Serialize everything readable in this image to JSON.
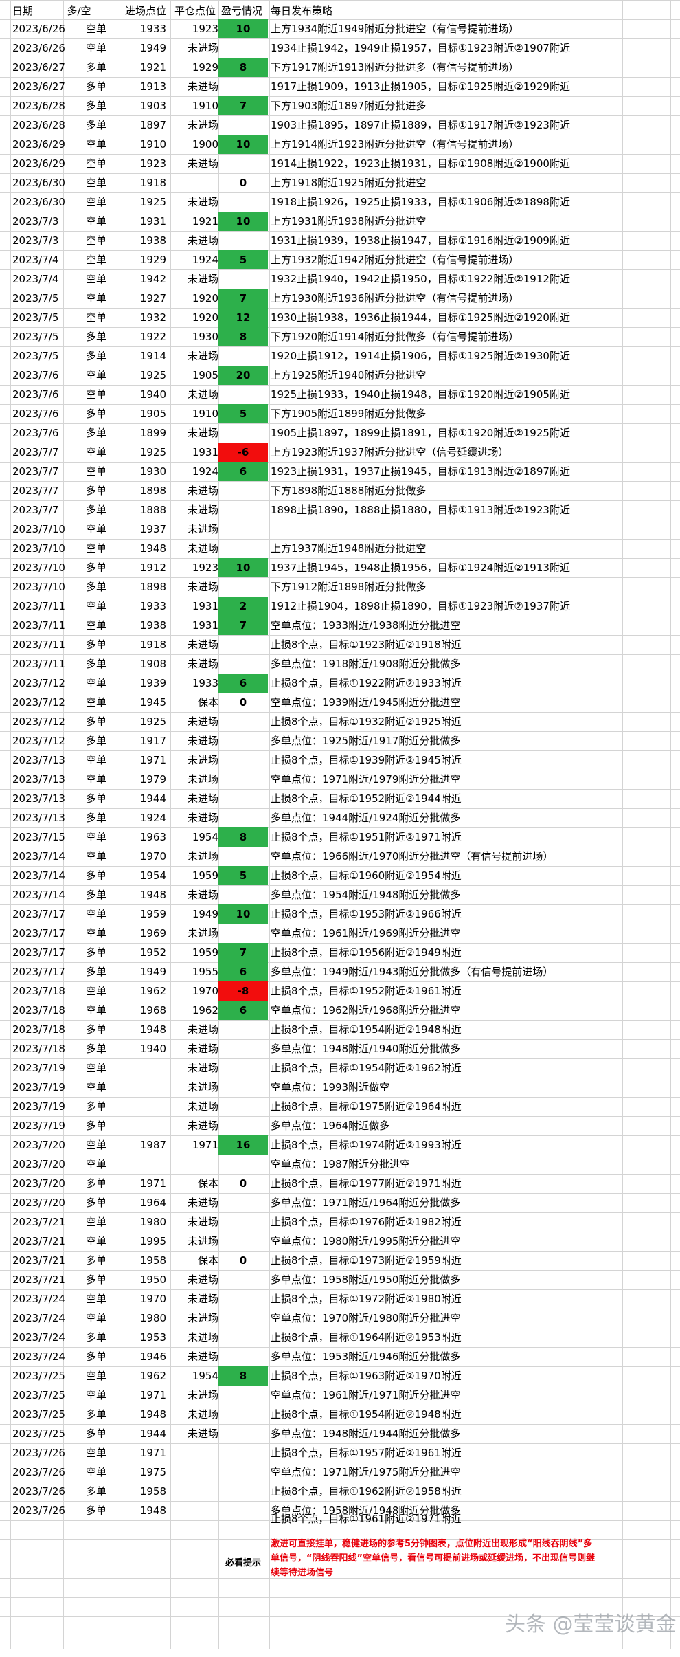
{
  "headers": [
    "日期",
    "多/空",
    "进场点位",
    "平仓点位",
    "盈亏情况",
    "每日发布策略"
  ],
  "rows": [
    [
      "2023/6/26",
      "空单",
      "1933",
      "1923",
      "10",
      "上方1934附近1949附近分批进空（有信号提前进场）"
    ],
    [
      "2023/6/26",
      "空单",
      "1949",
      "未进场",
      "",
      "1934止损1942，1949止损1957，目标①1923附近②1907附近"
    ],
    [
      "2023/6/27",
      "多单",
      "1921",
      "1929",
      "8",
      "下方1917附近1913附近分批进多（有信号提前进场）"
    ],
    [
      "2023/6/27",
      "多单",
      "1913",
      "未进场",
      "",
      "1917止损1909，1913止损1905，目标①1925附近②1929附近"
    ],
    [
      "2023/6/28",
      "多单",
      "1903",
      "1910",
      "7",
      "下方1903附近1897附近分批进多"
    ],
    [
      "2023/6/28",
      "多单",
      "1897",
      "未进场",
      "",
      "1903止损1895，1897止损1889，目标①1917附近②1923附近"
    ],
    [
      "2023/6/29",
      "空单",
      "1910",
      "1900",
      "10",
      "上方1914附近1923附近分批进空（有信号提前进场）"
    ],
    [
      "2023/6/29",
      "空单",
      "1923",
      "未进场",
      "",
      "1914止损1922，1923止损1931，目标①1908附近②1900附近"
    ],
    [
      "2023/6/30",
      "空单",
      "1918",
      "",
      "0",
      "上方1918附近1925附近分批进空"
    ],
    [
      "2023/6/30",
      "空单",
      "1925",
      "未进场",
      "",
      "1918止损1926，1925止损1933，目标①1906附近②1898附近"
    ],
    [
      "2023/7/3",
      "空单",
      "1931",
      "1921",
      "10",
      "上方1931附近1938附近分批进空"
    ],
    [
      "2023/7/3",
      "空单",
      "1938",
      "未进场",
      "",
      "1931止损1939，1938止损1947，目标①1916附近②1909附近"
    ],
    [
      "2023/7/4",
      "空单",
      "1929",
      "1924",
      "5",
      "上方1932附近1942附近分批进空（有信号提前进场）"
    ],
    [
      "2023/7/4",
      "空单",
      "1942",
      "未进场",
      "",
      "1932止损1940，1942止损1950，目标①1922附近②1912附近"
    ],
    [
      "2023/7/5",
      "空单",
      "1927",
      "1920",
      "7",
      "上方1930附近1936附近分批进空（有信号提前进场）"
    ],
    [
      "2023/7/5",
      "空单",
      "1932",
      "1920",
      "12",
      "1930止损1938，1936止损1944，目标①1925附近②1920附近"
    ],
    [
      "2023/7/5",
      "多单",
      "1922",
      "1930",
      "8",
      "下方1920附近1914附近分批做多（有信号提前进场）"
    ],
    [
      "2023/7/5",
      "多单",
      "1914",
      "未进场",
      "",
      "1920止损1912，1914止损1906，目标①1925附近②1930附近"
    ],
    [
      "2023/7/6",
      "空单",
      "1925",
      "1905",
      "20",
      "上方1925附近1940附近分批进空"
    ],
    [
      "2023/7/6",
      "空单",
      "1940",
      "未进场",
      "",
      "1925止损1933，1940止损1948，目标①1920附近②1905附近"
    ],
    [
      "2023/7/6",
      "多单",
      "1905",
      "1910",
      "5",
      "下方1905附近1899附近分批做多"
    ],
    [
      "2023/7/6",
      "多单",
      "1899",
      "未进场",
      "",
      "1905止损1897，1899止损1891，目标①1920附近②1925附近"
    ],
    [
      "2023/7/7",
      "空单",
      "1925",
      "1931",
      "-6",
      "上方1923附近1937附近分批进空（信号延缓进场）"
    ],
    [
      "2023/7/7",
      "空单",
      "1930",
      "1924",
      "6",
      "1923止损1931，1937止损1945，目标①1913附近②1897附近"
    ],
    [
      "2023/7/7",
      "多单",
      "1898",
      "未进场",
      "",
      "下方1898附近1888附近分批做多"
    ],
    [
      "2023/7/7",
      "多单",
      "1888",
      "未进场",
      "",
      "1898止损1890，1888止损1880，目标①1913附近②1923附近"
    ],
    [
      "2023/7/10",
      "空单",
      "1937",
      "未进场",
      "",
      ""
    ],
    [
      "2023/7/10",
      "空单",
      "1948",
      "未进场",
      "",
      "上方1937附近1948附近分批进空"
    ],
    [
      "2023/7/10",
      "多单",
      "1912",
      "1923",
      "10",
      "1937止损1945，1948止损1956，目标①1924附近②1913附近"
    ],
    [
      "2023/7/10",
      "多单",
      "1898",
      "未进场",
      "",
      "下方1912附近1898附近分批做多"
    ],
    [
      "2023/7/11",
      "空单",
      "1933",
      "1931",
      "2",
      "1912止损1904，1898止损1890，目标①1923附近②1937附近"
    ],
    [
      "2023/7/11",
      "空单",
      "1938",
      "1931",
      "7",
      "空单点位：1933附近/1938附近分批进空"
    ],
    [
      "2023/7/11",
      "多单",
      "1918",
      "未进场",
      "",
      "止损8个点，目标①1923附近②1918附近"
    ],
    [
      "2023/7/11",
      "多单",
      "1908",
      "未进场",
      "",
      "多单点位：1918附近/1908附近分批做多"
    ],
    [
      "2023/7/12",
      "空单",
      "1939",
      "1933",
      "6",
      "止损8个点，目标①1922附近②1933附近"
    ],
    [
      "2023/7/12",
      "空单",
      "1945",
      "保本",
      "0",
      "空单点位：1939附近/1945附近分批进空"
    ],
    [
      "2023/7/12",
      "多单",
      "1925",
      "未进场",
      "",
      "止损8个点，目标①1932附近②1925附近"
    ],
    [
      "2023/7/12",
      "多单",
      "1917",
      "未进场",
      "",
      "多单点位：1925附近/1917附近分批做多"
    ],
    [
      "2023/7/13",
      "空单",
      "1971",
      "未进场",
      "",
      "止损8个点，目标①1939附近②1945附近"
    ],
    [
      "2023/7/13",
      "空单",
      "1979",
      "未进场",
      "",
      "空单点位：1971附近/1979附近分批进空"
    ],
    [
      "2023/7/13",
      "多单",
      "1944",
      "未进场",
      "",
      "止损8个点，目标①1952附近②1944附近"
    ],
    [
      "2023/7/13",
      "多单",
      "1924",
      "未进场",
      "",
      "多单点位：1944附近/1924附近分批做多"
    ],
    [
      "2023/7/15",
      "空单",
      "1963",
      "1954",
      "8",
      "止损8个点，目标①1951附近②1971附近"
    ],
    [
      "2023/7/14",
      "空单",
      "1970",
      "未进场",
      "",
      "空单点位：1966附近/1970附近分批进空（有信号提前进场）"
    ],
    [
      "2023/7/14",
      "多单",
      "1954",
      "1959",
      "5",
      "止损8个点，目标①1960附近②1954附近"
    ],
    [
      "2023/7/14",
      "多单",
      "1948",
      "未进场",
      "",
      "多单点位：1954附近/1948附近分批做多"
    ],
    [
      "2023/7/17",
      "空单",
      "1959",
      "1949",
      "10",
      "止损8个点，目标①1953附近②1966附近"
    ],
    [
      "2023/7/17",
      "空单",
      "1969",
      "未进场",
      "",
      "空单点位：1961附近/1969附近分批进空"
    ],
    [
      "2023/7/17",
      "多单",
      "1952",
      "1959",
      "7",
      "止损8个点，目标①1956附近②1949附近"
    ],
    [
      "2023/7/17",
      "多单",
      "1949",
      "1955",
      "6",
      "多单点位：1949附近/1943附近分批做多（有信号提前进场）"
    ],
    [
      "2023/7/18",
      "空单",
      "1962",
      "1970",
      "-8",
      "止损8个点，目标①1952附近②1961附近"
    ],
    [
      "2023/7/18",
      "空单",
      "1968",
      "1962",
      "6",
      "空单点位：1962附近/1968附近分批进空"
    ],
    [
      "2023/7/18",
      "多单",
      "1948",
      "未进场",
      "",
      "止损8个点，目标①1954附近②1948附近"
    ],
    [
      "2023/7/18",
      "多单",
      "1940",
      "未进场",
      "",
      "多单点位：1948附近/1940附近分批做多"
    ],
    [
      "2023/7/19",
      "空单",
      "",
      "未进场",
      "",
      "止损8个点，目标①1954附近②1962附近"
    ],
    [
      "2023/7/19",
      "空单",
      "",
      "未进场",
      "",
      "空单点位：1993附近做空"
    ],
    [
      "2023/7/19",
      "多单",
      "",
      "未进场",
      "",
      "止损8个点，目标①1975附近②1964附近"
    ],
    [
      "2023/7/19",
      "多单",
      "",
      "未进场",
      "",
      "多单点位：1964附近做多"
    ],
    [
      "2023/7/20",
      "空单",
      "1987",
      "1971",
      "16",
      "止损8个点，目标①1974附近②1993附近"
    ],
    [
      "2023/7/20",
      "空单",
      "",
      "",
      "",
      "空单点位：1987附近分批进空"
    ],
    [
      "2023/7/20",
      "多单",
      "1971",
      "保本",
      "0",
      "止损8个点，目标①1977附近②1971附近"
    ],
    [
      "2023/7/20",
      "多单",
      "1964",
      "未进场",
      "",
      "多单点位：1971附近/1964附近分批做多"
    ],
    [
      "2023/7/21",
      "空单",
      "1980",
      "未进场",
      "",
      "止损8个点，目标①1976附近②1982附近"
    ],
    [
      "2023/7/21",
      "空单",
      "1995",
      "未进场",
      "",
      "空单点位：1980附近/1995附近分批进空"
    ],
    [
      "2023/7/21",
      "多单",
      "1958",
      "保本",
      "0",
      "止损8个点，目标①1973附近②1959附近"
    ],
    [
      "2023/7/21",
      "多单",
      "1950",
      "未进场",
      "",
      "多单点位：1958附近/1950附近分批做多"
    ],
    [
      "2023/7/24",
      "空单",
      "1970",
      "未进场",
      "",
      "止损8个点，目标①1972附近②1980附近"
    ],
    [
      "2023/7/24",
      "空单",
      "1980",
      "未进场",
      "",
      "空单点位：1970附近/1980附近分批进空"
    ],
    [
      "2023/7/24",
      "多单",
      "1953",
      "未进场",
      "",
      "止损8个点，目标①1964附近②1953附近"
    ],
    [
      "2023/7/24",
      "多单",
      "1946",
      "未进场",
      "",
      "多单点位：1953附近/1946附近分批做多"
    ],
    [
      "2023/7/25",
      "空单",
      "1962",
      "1954",
      "8",
      "止损8个点，目标①1963附近②1970附近"
    ],
    [
      "2023/7/25",
      "空单",
      "1971",
      "未进场",
      "",
      "空单点位：1961附近/1971附近分批进空"
    ],
    [
      "2023/7/25",
      "多单",
      "1948",
      "未进场",
      "",
      "止损8个点，目标①1954附近②1948附近"
    ],
    [
      "2023/7/25",
      "多单",
      "1944",
      "未进场",
      "",
      "多单点位：1948附近/1944附近分批做多"
    ],
    [
      "2023/7/26",
      "空单",
      "1971",
      "",
      "",
      "止损8个点，目标①1957附近②1961附近"
    ],
    [
      "2023/7/26",
      "空单",
      "1975",
      "",
      "",
      "空单点位：1971附近/1975附近分批进空"
    ],
    [
      "2023/7/26",
      "多单",
      "1958",
      "",
      "",
      "止损8个点，目标①1962附近②1958附近"
    ],
    [
      "2023/7/26",
      "多单",
      "1948",
      "",
      "",
      "多单点位：1958附近/1948附近分批做多"
    ]
  ],
  "last_strategy": "止损8个点，目标①1961附近②1971附近",
  "tip_title": "必看提示",
  "tip_body": "激进可直接挂单，稳健进场的参考5分钟图表，点位附近出现形成“阳线吞阴线”多单信号，“阴线吞阳线”空单信号，看信号可提前进场或延缓进场，不出现信号则继续等待进场信号",
  "watermark": "头条 @莹莹谈黄金",
  "colors": {
    "profit": "#2db04b",
    "loss": "#f20d0d",
    "tip": "#e8000b"
  }
}
